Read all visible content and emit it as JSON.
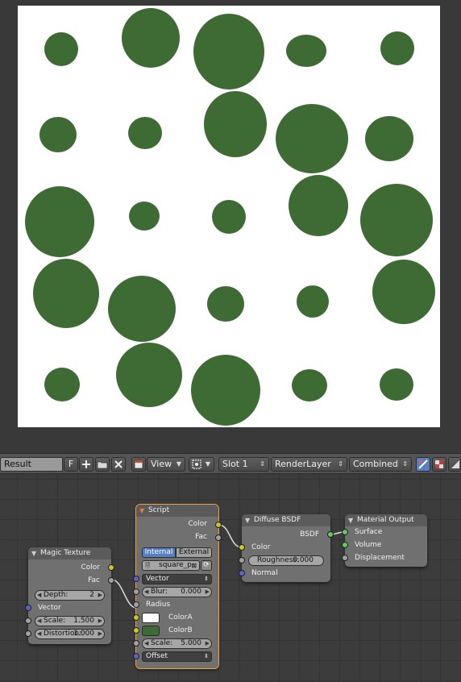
{
  "image_header": {
    "image_name": "Result",
    "fake_user": "F",
    "new_icon": "plus-icon",
    "open_icon": "folder-icon",
    "unlink_icon": "x-icon",
    "view_menu": "View",
    "slot": "Slot 1",
    "layer": "RenderLayer",
    "pass": "Combined"
  },
  "render": {
    "background": "#ffffff",
    "spot_color": "#3d6b33"
  },
  "nodes": {
    "magic_texture": {
      "title": "Magic Texture",
      "outputs": [
        "Color",
        "Fac"
      ],
      "depth_label": "Depth:",
      "depth_value": "2",
      "vector_label": "Vector",
      "scale_label": "Scale:",
      "scale_value": "1.500",
      "distortion_label": "Distortion:",
      "distortion_value": "1.000"
    },
    "script": {
      "title": "Script",
      "mode_internal": "Internal",
      "mode_external": "External",
      "script_name": "square_p",
      "outputs": [
        "Color",
        "Fac"
      ],
      "vector_menu": "Vector",
      "blur_label": "Blur:",
      "blur_value": "0.000",
      "radius_label": "Radius",
      "color_a_label": "ColorA",
      "color_b_label": "ColorB",
      "color_a": "#ffffff",
      "color_b": "#3d6b33",
      "scale_label": "Scale:",
      "scale_value": "5.000",
      "offset_menu": "Offset"
    },
    "diffuse": {
      "title": "Diffuse BSDF",
      "output": "BSDF",
      "color_label": "Color",
      "roughness_label": "Roughness:",
      "roughness_value": "0.000",
      "normal_label": "Normal"
    },
    "material_output": {
      "title": "Material Output",
      "surface_label": "Surface",
      "volume_label": "Volume",
      "displacement_label": "Displacement"
    }
  }
}
